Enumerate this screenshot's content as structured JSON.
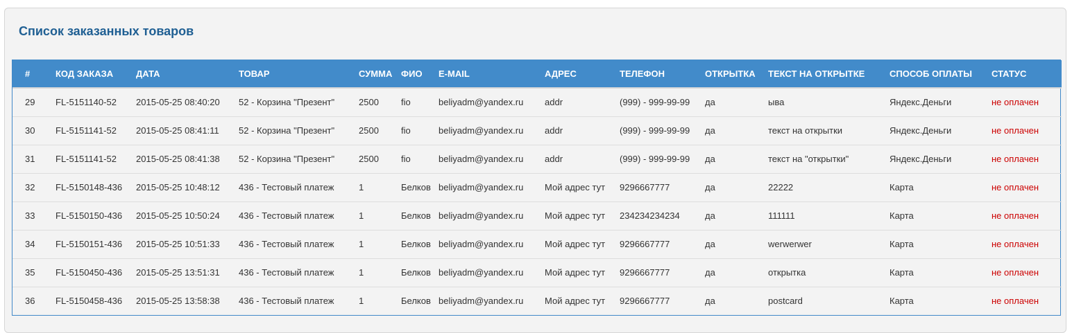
{
  "panel": {
    "title": "Список заказанных товаров"
  },
  "table": {
    "columns": [
      "#",
      "КОД ЗАКАЗА",
      "ДАТА",
      "ТОВАР",
      "СУММА",
      "ФИО",
      "E-MAIL",
      "АДРЕС",
      "ТЕЛЕФОН",
      "ОТКРЫТКА",
      "ТЕКСТ НА ОТКРЫТКЕ",
      "СПОСОБ ОПЛАТЫ",
      "СТАТУС"
    ],
    "rows": [
      [
        "29",
        "FL-5151140-52",
        "2015-05-25 08:40:20",
        "52 - Корзина \"Презент\"",
        "2500",
        "fio",
        "beliyadm@yandex.ru",
        "addr",
        "(999) - 999-99-99",
        "да",
        "ыва",
        "Яндекс.Деньги",
        "не оплачен"
      ],
      [
        "30",
        "FL-5151141-52",
        "2015-05-25 08:41:11",
        "52 - Корзина \"Презент\"",
        "2500",
        "fio",
        "beliyadm@yandex.ru",
        "addr",
        "(999) - 999-99-99",
        "да",
        "текст на открытки",
        "Яндекс.Деньги",
        "не оплачен"
      ],
      [
        "31",
        "FL-5151141-52",
        "2015-05-25 08:41:38",
        "52 - Корзина \"Презент\"",
        "2500",
        "fio",
        "beliyadm@yandex.ru",
        "addr",
        "(999) - 999-99-99",
        "да",
        "текст на \"открытки\"",
        "Яндекс.Деньги",
        "не оплачен"
      ],
      [
        "32",
        "FL-5150148-436",
        "2015-05-25 10:48:12",
        "436 - Тестовый платеж",
        "1",
        "Белков",
        "beliyadm@yandex.ru",
        "Мой адрес тут",
        "9296667777",
        "да",
        "22222",
        "Карта",
        "не оплачен"
      ],
      [
        "33",
        "FL-5150150-436",
        "2015-05-25 10:50:24",
        "436 - Тестовый платеж",
        "1",
        "Белков",
        "beliyadm@yandex.ru",
        "Мой адрес тут",
        "234234234234",
        "да",
        "111111",
        "Карта",
        "не оплачен"
      ],
      [
        "34",
        "FL-5150151-436",
        "2015-05-25 10:51:33",
        "436 - Тестовый платеж",
        "1",
        "Белков",
        "beliyadm@yandex.ru",
        "Мой адрес тут",
        "9296667777",
        "да",
        "werwerwer",
        "Карта",
        "не оплачен"
      ],
      [
        "35",
        "FL-5150450-436",
        "2015-05-25 13:51:31",
        "436 - Тестовый платеж",
        "1",
        "Белков",
        "beliyadm@yandex.ru",
        "Мой адрес тут",
        "9296667777",
        "да",
        "открытка",
        "Карта",
        "не оплачен"
      ],
      [
        "36",
        "FL-5150458-436",
        "2015-05-25 13:58:38",
        "436 - Тестовый платеж",
        "1",
        "Белков",
        "beliyadm@yandex.ru",
        "Мой адрес тут",
        "9296667777",
        "да",
        "postcard",
        "Карта",
        "не оплачен"
      ]
    ]
  },
  "colors": {
    "header_bg": "#428bca",
    "title": "#1f5f93",
    "status_unpaid": "#cc0000"
  }
}
